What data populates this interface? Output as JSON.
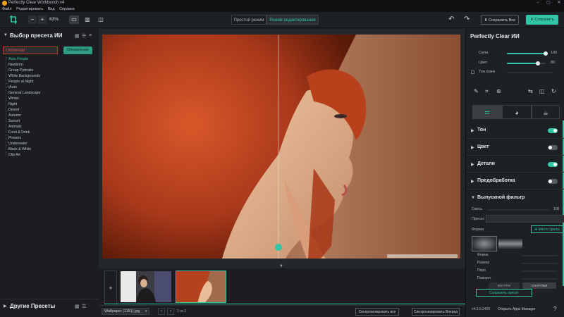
{
  "window": {
    "title": "Perfectly Clear Workbench v4"
  },
  "menu": [
    "Файл",
    "Редактировать",
    "Вид",
    "Справка"
  ],
  "toolbar": {
    "zoom_minus": "−",
    "zoom_plus": "+",
    "zoom": "63%",
    "mode_simple": "Простой режим",
    "mode_edit": "Режим редактирования",
    "save_all": "Сохранить Все",
    "save": "Сохранить"
  },
  "left": {
    "header": "Выбор пресета ИИ",
    "dropdown_value": "Universal",
    "update_button": "Обновление",
    "presets": [
      "Auto People",
      "Newborn",
      "Group Portraits",
      "White Backgrounds",
      "People at Night",
      "iAuto",
      "General Landscape",
      "Winter",
      "Night",
      "Desert",
      "Autumn",
      "Sunset",
      "Animals",
      "Food & Drink",
      "Flowers",
      "Underwater",
      "Black & White",
      "Clip Art"
    ],
    "other_presets": "Другие Пресеты"
  },
  "filmstrip": {
    "add": "+",
    "file_select": "Wallpaper (1181).jpg",
    "pager": "2 из 2",
    "sync_all": "Синхронизировать все",
    "sync_forward": "Синхронизировать Вперед"
  },
  "right": {
    "title": "Perfectly Clear ИИ",
    "strength_label": "Сила",
    "strength_value": "100",
    "color_label": "Цвет",
    "color_value": "80",
    "skin_tone_label": "Тон кожи",
    "sections": [
      {
        "label": "Тон",
        "on": true
      },
      {
        "label": "Цвет",
        "on": false
      },
      {
        "label": "Детали",
        "on": true
      },
      {
        "label": "Предобработка",
        "on": false
      }
    ],
    "filter": {
      "title": "Выпускной фильтр",
      "mix_label": "Смесь",
      "mix_value": "100",
      "preset_label": "Пресет",
      "shape_label": "Форма",
      "place_center": "Место Центр",
      "shape_rows": [
        "Форма",
        "Размер",
        "Перо",
        "Поворот"
      ],
      "mode_out": "ВНУТРИ",
      "mode_in": "СНАРУЖИ",
      "save_preset": "Сохранить пресет"
    },
    "version": "v4.3.0.2400",
    "apps_manager": "Открыть Apps Manager"
  },
  "colors": {
    "accent": "#31c6a5",
    "background": "#1b1d20",
    "panel": "#1e2124"
  }
}
